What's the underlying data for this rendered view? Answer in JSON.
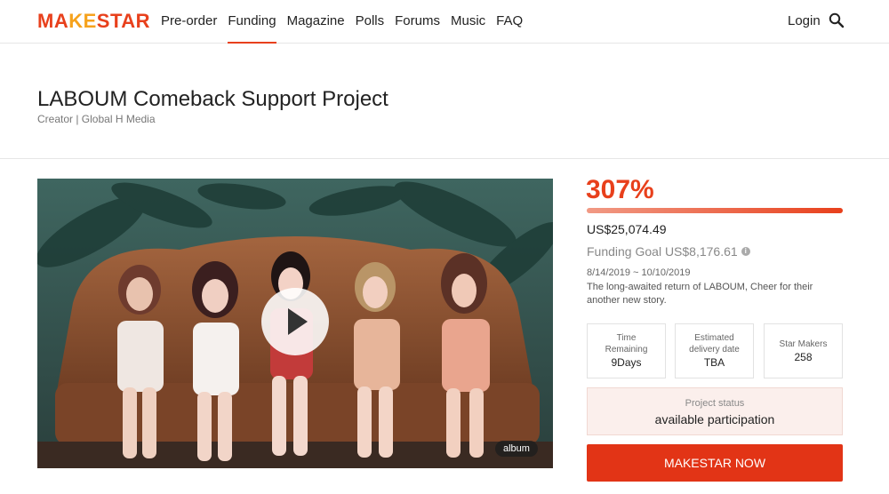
{
  "header": {
    "logo": {
      "part1": "MA",
      "part2": "KE",
      "part3": "STAR"
    },
    "nav": [
      "Pre-order",
      "Funding",
      "Magazine",
      "Polls",
      "Forums",
      "Music",
      "FAQ"
    ],
    "active_nav": "Funding",
    "login_label": "Login",
    "search_icon": "search-icon"
  },
  "project": {
    "title": "LABOUM Comeback Support Project",
    "creator": "Creator | Global H Media"
  },
  "media": {
    "play_icon": "play-icon",
    "badge": "album"
  },
  "funding": {
    "percent": "307%",
    "progress_fraction": 1.0,
    "raised": "US$25,074.49",
    "goal": "Funding Goal US$8,176.61",
    "info_icon": "info-icon",
    "dates": "8/14/2019 ~ 10/10/2019",
    "description": "The long-awaited return of LABOUM, Cheer for their another new story."
  },
  "stats": [
    {
      "label": "Time\nRemaining",
      "value": "9Days"
    },
    {
      "label": "Estimated\ndelivery date",
      "value": "TBA"
    },
    {
      "label": "Star Makers",
      "value": "258"
    }
  ],
  "status": {
    "label": "Project status",
    "value": "available participation"
  },
  "cta_label": "MAKESTAR NOW",
  "colors": {
    "accent": "#e8401c",
    "logo_orange": "#f6a21c",
    "cta": "#e23416",
    "status_bg": "#fbefec"
  }
}
